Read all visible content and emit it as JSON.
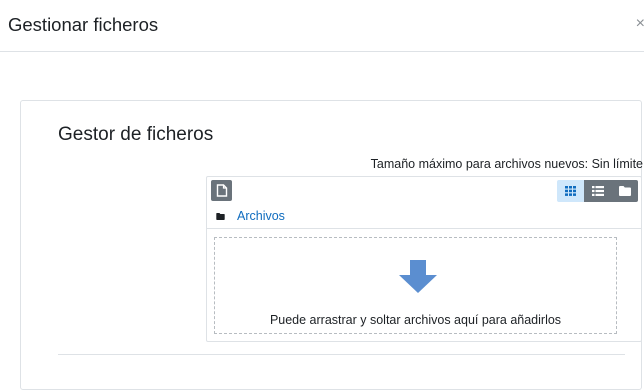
{
  "dialog": {
    "title": "Gestionar ficheros",
    "close_label": "×"
  },
  "file_manager": {
    "heading": "Gestor de ficheros",
    "max_size_text": "Tamaño máximo para archivos nuevos: Sin límite",
    "path_folder_label": "Archivos",
    "drop_hint": "Puede arrastrar y soltar archivos aquí para añadirlos",
    "view_modes": [
      "icons",
      "list",
      "tree"
    ],
    "active_view": "icons",
    "icons": {
      "add": "add-file-icon",
      "view_icons": "grid-icon",
      "view_list": "list-icon",
      "view_tree": "folder-icon",
      "path_folder": "folder-icon",
      "drop": "down-arrow-icon"
    },
    "colors": {
      "link": "#0f6cbf",
      "button": "#6a737b",
      "active_button": "#cfe7fb",
      "arrow": "#5b8ed0"
    }
  }
}
